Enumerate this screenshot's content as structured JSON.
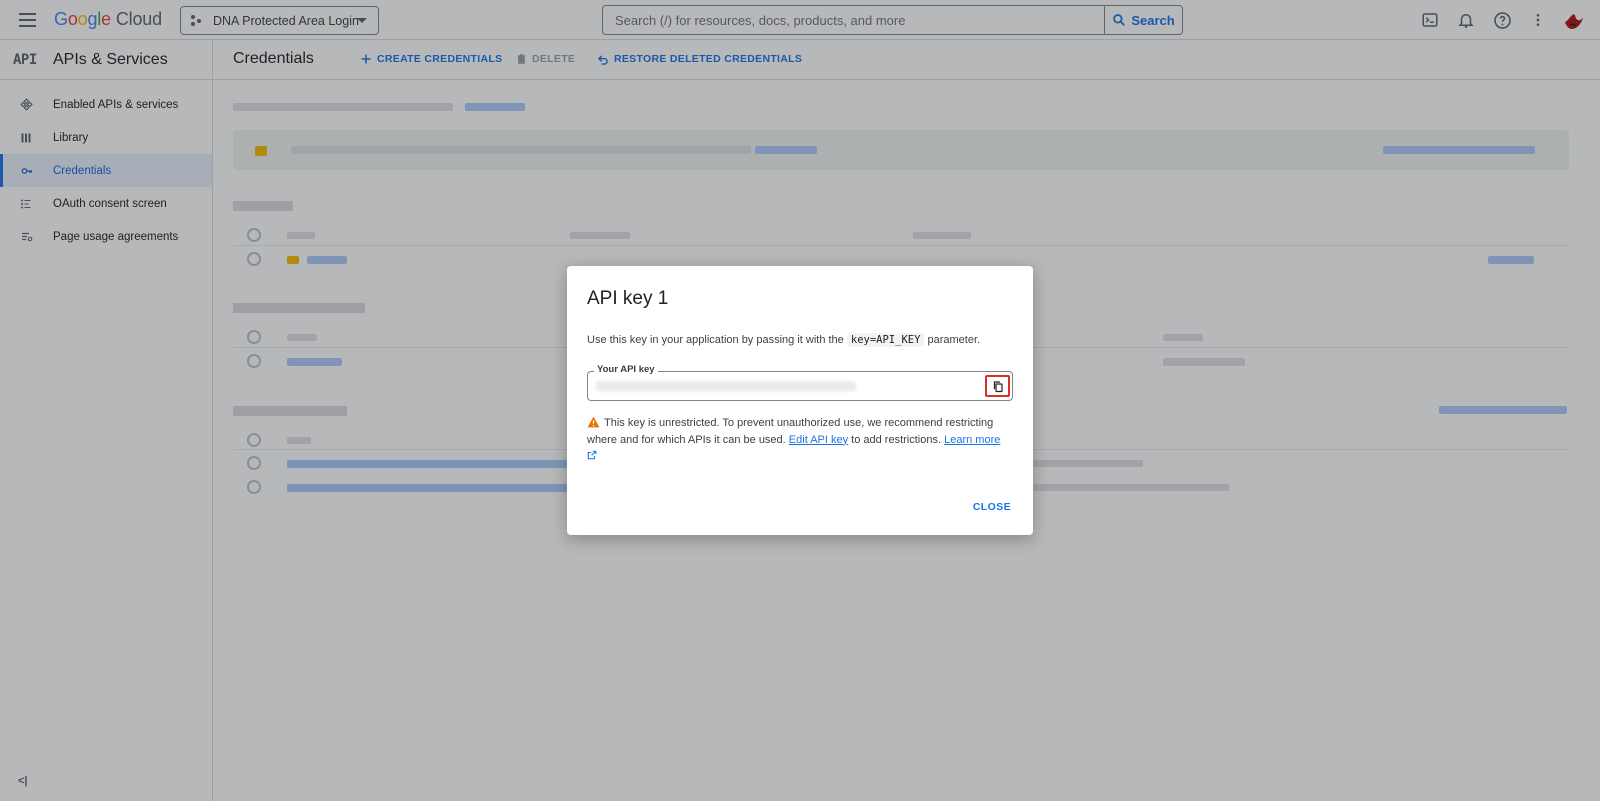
{
  "topbar": {
    "logo": {
      "google": "Google",
      "cloud": "Cloud"
    },
    "project": "DNA Protected Area Login",
    "search": {
      "placeholder": "Search (/) for resources, docs, products, and more",
      "button": "Search"
    }
  },
  "sidebar": {
    "title": "APIs & Services",
    "logo_text": "API",
    "items": [
      {
        "label": "Enabled APIs & services",
        "icon": "hub-icon"
      },
      {
        "label": "Library",
        "icon": "library-icon"
      },
      {
        "label": "Credentials",
        "icon": "key-icon",
        "active": true
      },
      {
        "label": "OAuth consent screen",
        "icon": "consent-icon"
      },
      {
        "label": "Page usage agreements",
        "icon": "settings-list-icon"
      }
    ],
    "collapse": "<|"
  },
  "header": {
    "title": "Credentials",
    "actions": {
      "create": "CREATE CREDENTIALS",
      "delete": "DELETE",
      "restore": "RESTORE DELETED CREDENTIALS"
    }
  },
  "dialog": {
    "title": "API key 1",
    "desc_before": "Use this key in your application by passing it with the",
    "desc_code": "key=API_KEY",
    "desc_after": "parameter.",
    "field_label": "Your API key",
    "warning_text": "This key is unrestricted. To prevent unauthorized use, we recommend restricting where and for which APIs it can be used.",
    "edit_link": "Edit API key",
    "warning_mid": "to add restrictions.",
    "learn_link": "Learn more",
    "close": "CLOSE"
  },
  "colors": {
    "accent": "#1a73e8",
    "warning": "#e37400",
    "highlight": "#d93025"
  }
}
